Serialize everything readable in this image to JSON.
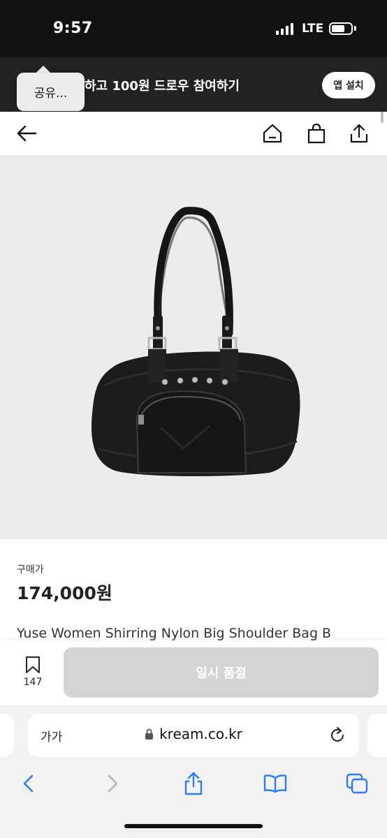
{
  "status_bar": {
    "time": "9:57",
    "network": "LTE"
  },
  "app_banner": {
    "text": "하고 100원 드로우 참여하기",
    "install_label": "앱 설치"
  },
  "share_tooltip": {
    "label": "공유..."
  },
  "header": {
    "icons": [
      "back-arrow-icon",
      "home-icon",
      "shopping-bag-icon",
      "share-icon"
    ]
  },
  "product": {
    "price_label": "구매가",
    "price": "174,000원",
    "name": "Yuse Women Shirring Nylon Big Shoulder Bag B"
  },
  "action_bar": {
    "wish_count": "147",
    "soldout_label": "일시 품절"
  },
  "safari": {
    "text_size_label": "가가",
    "url": "kream.co.kr"
  },
  "colors": {
    "status_bar_bg": "#111111",
    "banner_bg": "#222222",
    "image_bg": "#ececec",
    "soldout_btn_bg": "#d4d4d4",
    "safari_blue": "#2f7bf5"
  }
}
